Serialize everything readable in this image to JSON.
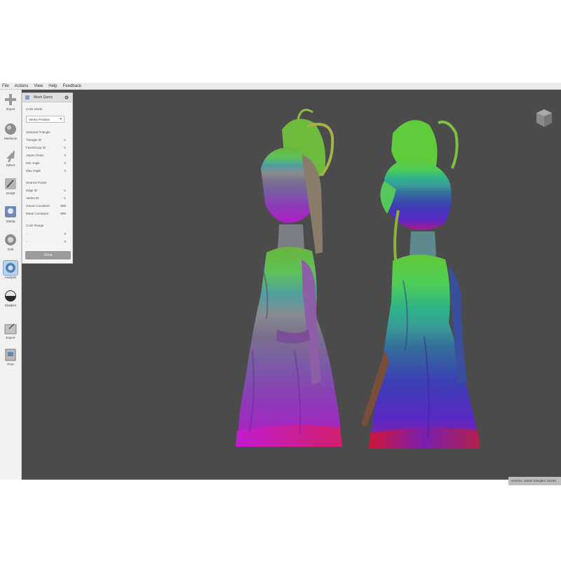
{
  "menu": [
    "File",
    "Actions",
    "View",
    "Help",
    "Feedback"
  ],
  "tools": [
    {
      "label": "Import",
      "icon": "plus-icon"
    },
    {
      "label": "Meshmix",
      "icon": "meshmix-sphere-icon"
    },
    {
      "label": "Select",
      "icon": "select-arrow-icon"
    },
    {
      "label": "Sculpt",
      "icon": "sculpt-brush-icon"
    },
    {
      "label": "Stamp",
      "icon": "stamp-icon"
    },
    {
      "label": "Edit",
      "icon": "edit-icon"
    },
    {
      "label": "Analysis",
      "icon": "analysis-icon"
    },
    {
      "label": "Shaders",
      "icon": "shaders-icon"
    },
    {
      "label": "Export",
      "icon": "export-icon"
    },
    {
      "label": "Print",
      "icon": "print-icon"
    }
  ],
  "panel": {
    "title": "Mesh Query",
    "color_mode_label": "Color Mode",
    "color_mode_value": "Vertex Position",
    "selected_triangle_label": "Selected Triangle",
    "rows1": [
      {
        "label": "Triangle ID",
        "value": "-1"
      },
      {
        "label": "FaceGroup ID",
        "value": "-1"
      },
      {
        "label": "Aspect Ratio",
        "value": "0"
      },
      {
        "label": "Min Angle",
        "value": "0"
      },
      {
        "label": "Max Angle",
        "value": "0"
      }
    ],
    "nearest_point_label": "Nearest Points",
    "rows2": [
      {
        "label": "Edge ID",
        "value": "-1"
      },
      {
        "label": "Vertex ID",
        "value": "-1"
      },
      {
        "label": "Gauss Curvature",
        "value": "-999"
      },
      {
        "label": "Mean Curvature",
        "value": "-999"
      }
    ],
    "color_range_label": "Color Range",
    "range_rows": [
      {
        "label": "-",
        "value": "0"
      },
      {
        "label": "-",
        "value": "0"
      }
    ],
    "done_label": "Done"
  },
  "status": "vertices: 26000 triangles: 55156",
  "colors": {
    "viewport": "#4b4b4b",
    "toolbar": "#f1f1f1",
    "panel": "#f4f4f4",
    "active_tool": "#bcd3ea"
  }
}
